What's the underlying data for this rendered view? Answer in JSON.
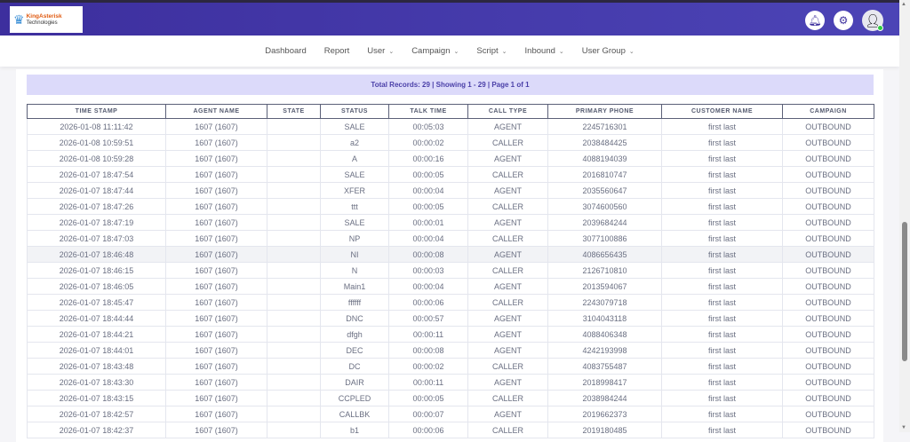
{
  "header": {
    "logo_text": "KingAsterisk Technologies",
    "logo_brand": "KingAsterisk",
    "logo_sub": "Technologies"
  },
  "nav": [
    {
      "label": "Dashboard",
      "dropdown": false
    },
    {
      "label": "Report",
      "dropdown": false
    },
    {
      "label": "User",
      "dropdown": true
    },
    {
      "label": "Campaign",
      "dropdown": true
    },
    {
      "label": "Script",
      "dropdown": true
    },
    {
      "label": "Inbound",
      "dropdown": true
    },
    {
      "label": "User Group",
      "dropdown": true
    }
  ],
  "summary": "Total Records: 29 | Showing 1 - 29 | Page 1 of 1",
  "columns": [
    "TIME STAMP",
    "AGENT NAME",
    "STATE",
    "STATUS",
    "TALK TIME",
    "CALL TYPE",
    "PRIMARY PHONE",
    "CUSTOMER NAME",
    "CAMPAIGN"
  ],
  "rows": [
    [
      "2026-01-08 11:11:42",
      "1607 (1607)",
      "",
      "SALE",
      "00:05:03",
      "AGENT",
      "2245716301",
      "first last",
      "OUTBOUND"
    ],
    [
      "2026-01-08 10:59:51",
      "1607 (1607)",
      "",
      "a2",
      "00:00:02",
      "CALLER",
      "2038484425",
      "first last",
      "OUTBOUND"
    ],
    [
      "2026-01-08 10:59:28",
      "1607 (1607)",
      "",
      "A",
      "00:00:16",
      "AGENT",
      "4088194039",
      "first last",
      "OUTBOUND"
    ],
    [
      "2026-01-07 18:47:54",
      "1607 (1607)",
      "",
      "SALE",
      "00:00:05",
      "CALLER",
      "2016810747",
      "first last",
      "OUTBOUND"
    ],
    [
      "2026-01-07 18:47:44",
      "1607 (1607)",
      "",
      "XFER",
      "00:00:04",
      "AGENT",
      "2035560647",
      "first last",
      "OUTBOUND"
    ],
    [
      "2026-01-07 18:47:26",
      "1607 (1607)",
      "",
      "ttt",
      "00:00:05",
      "CALLER",
      "3074600560",
      "first last",
      "OUTBOUND"
    ],
    [
      "2026-01-07 18:47:19",
      "1607 (1607)",
      "",
      "SALE",
      "00:00:01",
      "AGENT",
      "2039684244",
      "first last",
      "OUTBOUND"
    ],
    [
      "2026-01-07 18:47:03",
      "1607 (1607)",
      "",
      "NP",
      "00:00:04",
      "CALLER",
      "3077100886",
      "first last",
      "OUTBOUND"
    ],
    [
      "2026-01-07 18:46:48",
      "1607 (1607)",
      "",
      "NI",
      "00:00:08",
      "AGENT",
      "4086656435",
      "first last",
      "OUTBOUND"
    ],
    [
      "2026-01-07 18:46:15",
      "1607 (1607)",
      "",
      "N",
      "00:00:03",
      "CALLER",
      "2126710810",
      "first last",
      "OUTBOUND"
    ],
    [
      "2026-01-07 18:46:05",
      "1607 (1607)",
      "",
      "Main1",
      "00:00:04",
      "AGENT",
      "2013594067",
      "first last",
      "OUTBOUND"
    ],
    [
      "2026-01-07 18:45:47",
      "1607 (1607)",
      "",
      "ffffff",
      "00:00:06",
      "CALLER",
      "2243079718",
      "first last",
      "OUTBOUND"
    ],
    [
      "2026-01-07 18:44:44",
      "1607 (1607)",
      "",
      "DNC",
      "00:00:57",
      "AGENT",
      "3104043118",
      "first last",
      "OUTBOUND"
    ],
    [
      "2026-01-07 18:44:21",
      "1607 (1607)",
      "",
      "dfgh",
      "00:00:11",
      "AGENT",
      "4088406348",
      "first last",
      "OUTBOUND"
    ],
    [
      "2026-01-07 18:44:01",
      "1607 (1607)",
      "",
      "DEC",
      "00:00:08",
      "AGENT",
      "4242193998",
      "first last",
      "OUTBOUND"
    ],
    [
      "2026-01-07 18:43:48",
      "1607 (1607)",
      "",
      "DC",
      "00:00:02",
      "CALLER",
      "4083755487",
      "first last",
      "OUTBOUND"
    ],
    [
      "2026-01-07 18:43:30",
      "1607 (1607)",
      "",
      "DAIR",
      "00:00:11",
      "AGENT",
      "2018998417",
      "first last",
      "OUTBOUND"
    ],
    [
      "2026-01-07 18:43:15",
      "1607 (1607)",
      "",
      "CCPLED",
      "00:00:05",
      "CALLER",
      "2038984244",
      "first last",
      "OUTBOUND"
    ],
    [
      "2026-01-07 18:42:57",
      "1607 (1607)",
      "",
      "CALLBK",
      "00:00:07",
      "AGENT",
      "2019662373",
      "first last",
      "OUTBOUND"
    ],
    [
      "2026-01-07 18:42:37",
      "1607 (1607)",
      "",
      "b1",
      "00:00:06",
      "CALLER",
      "2019180485",
      "first last",
      "OUTBOUND"
    ]
  ],
  "highlighted_row": 8,
  "colors": {
    "header": "#3d2f9e",
    "summary_bg": "#dcdafa",
    "summary_text": "#4a3fa8"
  }
}
